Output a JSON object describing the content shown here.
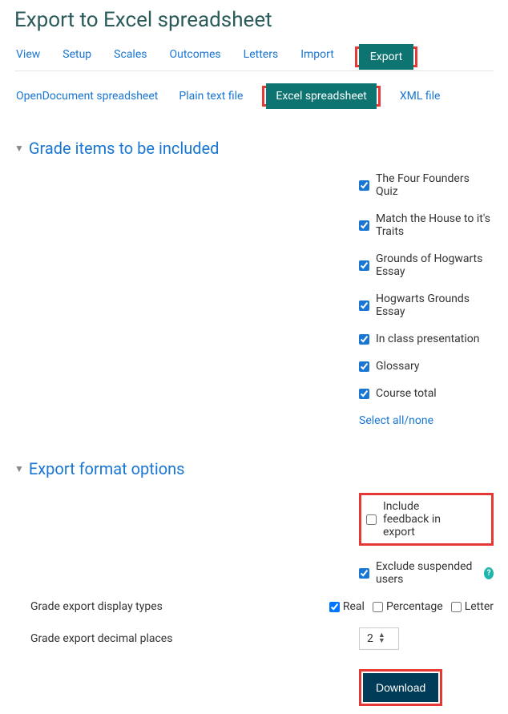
{
  "page_title": "Export to Excel spreadsheet",
  "top_tabs": {
    "view": "View",
    "setup": "Setup",
    "scales": "Scales",
    "outcomes": "Outcomes",
    "letters": "Letters",
    "import": "Import",
    "export": "Export"
  },
  "sub_tabs": {
    "opendoc": "OpenDocument spreadsheet",
    "plain": "Plain text file",
    "excel": "Excel spreadsheet",
    "xml": "XML file"
  },
  "sections": {
    "grade_items_title": "Grade items to be included",
    "export_format_title": "Export format options"
  },
  "grade_items": {
    "item0": "The Four Founders Quiz",
    "item1": "Match the House to it's Traits",
    "item2": "Grounds of Hogwarts Essay",
    "item3": "Hogwarts Grounds Essay",
    "item4": "In class presentation",
    "item5": "Glossary",
    "item6": "Course total",
    "select_all": "Select all/none"
  },
  "export_options": {
    "include_feedback": "Include feedback in export",
    "exclude_suspended": "Exclude suspended users",
    "display_types_label": "Grade export display types",
    "real": "Real",
    "percentage": "Percentage",
    "letter": "Letter",
    "decimal_label": "Grade export decimal places",
    "decimal_value": "2"
  },
  "download_label": "Download"
}
